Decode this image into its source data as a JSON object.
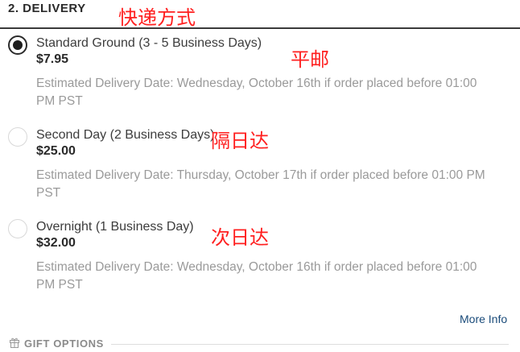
{
  "section": {
    "title": "2. DELIVERY"
  },
  "annotations": {
    "title_note": "快递方式",
    "standard_note": "平邮",
    "second_day_note": "隔日达",
    "overnight_note": "次日达",
    "color": "#ff1f1f"
  },
  "delivery_options": [
    {
      "label": "Standard Ground (3 - 5 Business Days)",
      "price": "$7.95",
      "estimate_line1": "Estimated Delivery Date:  Wednesday, October 16th if order placed before 01:00",
      "estimate_line2": "PM PST",
      "selected": true
    },
    {
      "label": "Second Day (2 Business Days)",
      "price": "$25.00",
      "estimate_line1": "Estimated Delivery Date:  Thursday, October 17th if order placed before 01:00 PM",
      "estimate_line2": "PST",
      "selected": false
    },
    {
      "label": "Overnight (1 Business Day)",
      "price": "$32.00",
      "estimate_line1": "Estimated Delivery Date:  Wednesday, October 16th if order placed before 01:00",
      "estimate_line2": "PM PST",
      "selected": false
    }
  ],
  "more_info": {
    "label": "More Info"
  },
  "gift_options": {
    "label": "GIFT OPTIONS",
    "icon": "gift-icon"
  }
}
